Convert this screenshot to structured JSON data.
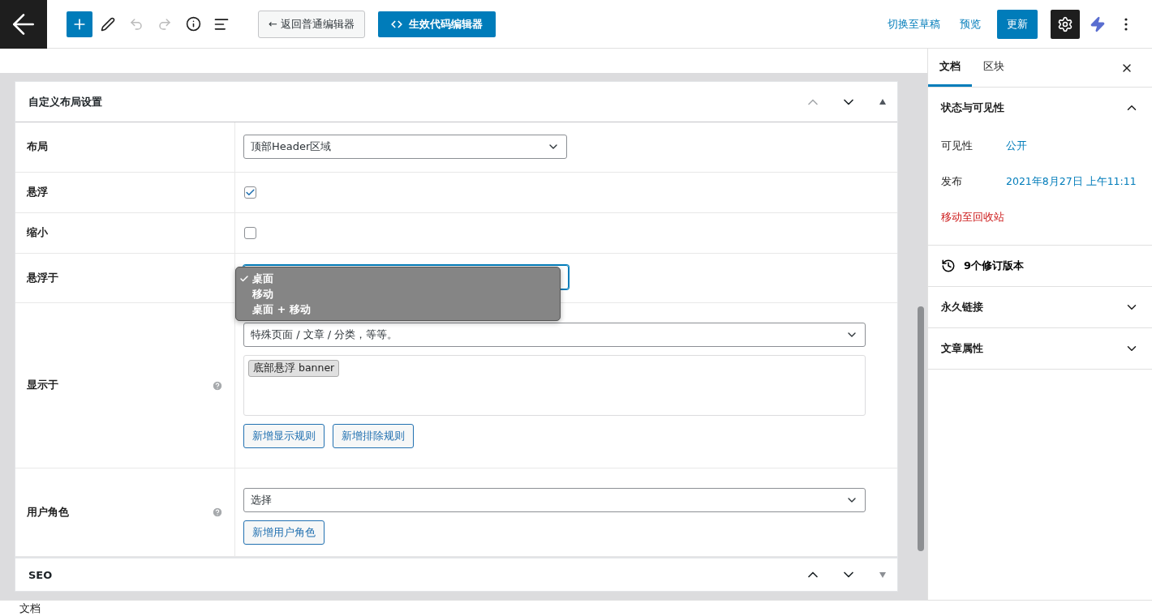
{
  "toolbar": {
    "back_button": "← 返回普通编辑器",
    "code_button": "生效代码编辑器",
    "draft_link": "切换至草稿",
    "preview_link": "预览",
    "update_button": "更新",
    "settings_active": true
  },
  "metabox": {
    "title": "自定义布局设置",
    "rows": [
      {
        "kind": "select",
        "label": "布局",
        "value": "顶部Header区域"
      },
      {
        "kind": "checkbox",
        "label": "悬浮",
        "checked": true
      },
      {
        "kind": "checkbox",
        "label": "缩小",
        "checked": false
      },
      {
        "kind": "popup",
        "label": "悬浮于",
        "options": [
          {
            "label": "桌面",
            "selected": true
          },
          {
            "label": "移动",
            "selected": false
          },
          {
            "label": "桌面 + 移动",
            "selected": false
          }
        ]
      },
      {
        "kind": "rules",
        "label": "显示于",
        "help": true,
        "value": "特殊页面 / 文章 / 分类，等等。",
        "tags": [
          "底部悬浮 banner"
        ],
        "buttons": [
          "新增显示规则",
          "新增排除规则"
        ]
      },
      {
        "kind": "roles",
        "label": "用户角色",
        "help": true,
        "value": "选择",
        "buttons": [
          "新增用户角色"
        ]
      }
    ]
  },
  "seo_box": {
    "title": "SEO"
  },
  "sidebar": {
    "tabs": [
      {
        "label": "文档",
        "selected": true
      },
      {
        "label": "区块",
        "selected": false
      }
    ],
    "status_panel": {
      "title": "状态与可见性",
      "expanded": true,
      "fields": [
        {
          "label": "可见性",
          "value": "公开"
        },
        {
          "label": "发布",
          "value": "2021年8月27日 上午11:11"
        }
      ],
      "trash_link": "移动至回收站"
    },
    "revisions": "9个修订版本",
    "panels": [
      {
        "title": "永久链接",
        "expanded": false
      },
      {
        "title": "文章属性",
        "expanded": false
      }
    ]
  },
  "footer": {
    "breadcrumb": "文档"
  }
}
